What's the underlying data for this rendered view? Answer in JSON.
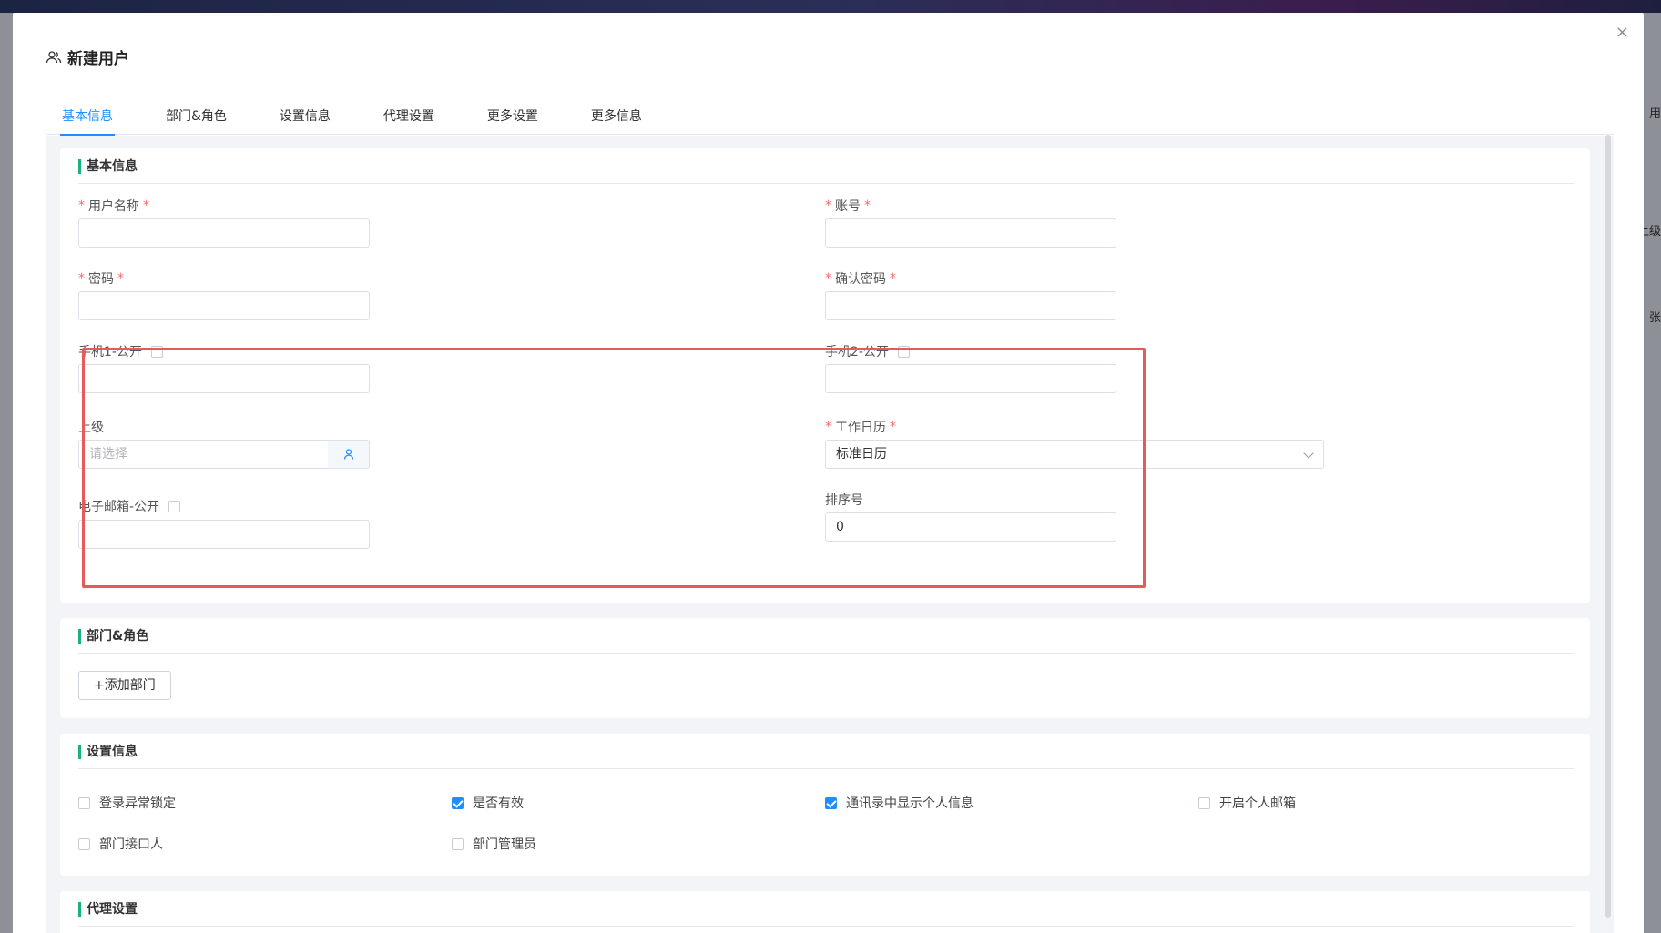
{
  "background": {
    "right_texts": [
      "用",
      "上级",
      "张"
    ]
  },
  "dialog": {
    "title": "新建用户",
    "close_glyph": "×",
    "tabs": [
      "基本信息",
      "部门&角色",
      "设置信息",
      "代理设置",
      "更多设置",
      "更多信息"
    ],
    "active_tab": 0
  },
  "basic": {
    "section_title": "基本信息",
    "username_label": "用户名称",
    "account_label": "账号",
    "password_label": "密码",
    "confirm_password_label": "确认密码",
    "phone1_label": "手机1-公开",
    "phone2_label": "手机2-公开",
    "superior_label": "上级",
    "superior_placeholder": "请选择",
    "calendar_label": "工作日历",
    "calendar_value": "标准日历",
    "email_label": "电子邮箱-公开",
    "sort_label": "排序号",
    "sort_value": "0",
    "required_mark": "*"
  },
  "dept": {
    "section_title": "部门&角色",
    "add_button": "+添加部门"
  },
  "settings": {
    "section_title": "设置信息",
    "options": [
      {
        "label": "登录异常锁定",
        "checked": false
      },
      {
        "label": "是否有效",
        "checked": true
      },
      {
        "label": "通讯录中显示个人信息",
        "checked": true
      },
      {
        "label": "开启个人邮箱",
        "checked": false
      },
      {
        "label": "部门接口人",
        "checked": false
      },
      {
        "label": "部门管理员",
        "checked": false
      }
    ]
  },
  "proxy": {
    "section_title": "代理设置"
  },
  "colors": {
    "accent": "#1e8fff",
    "section_bar": "#19b27a",
    "required": "#f56c6c",
    "highlight": "#e85a5a"
  }
}
